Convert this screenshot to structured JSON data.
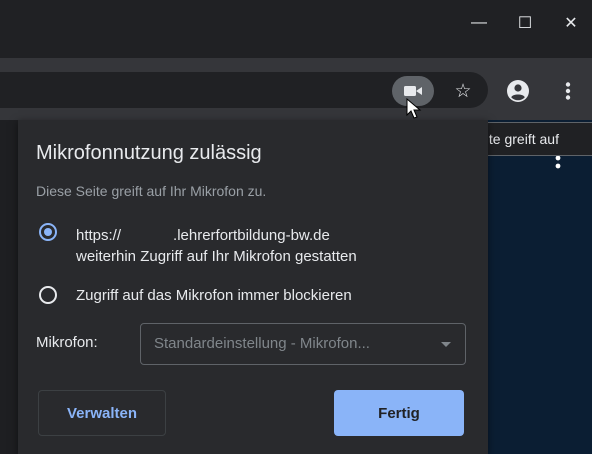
{
  "window": {
    "minimize_glyph": "—",
    "maximize_glyph": "☐",
    "close_glyph": "✕"
  },
  "toolbar": {
    "icons": [
      "camera-icon",
      "star-icon",
      "profile-icon",
      "menu-icon"
    ],
    "star_glyph": "☆"
  },
  "tooltip": {
    "text": "Diese Seite greift auf"
  },
  "popup": {
    "title": "Mikrofonnutzung zulässig",
    "description": "Diese Seite greift auf Ihr Mikrofon zu.",
    "options": [
      {
        "line1_prefix": "https://",
        "line1_suffix": ".lehrerfortbildung-bw.de",
        "line2": "weiterhin Zugriff auf Ihr Mikrofon gestatten",
        "selected": true
      },
      {
        "line1": "Zugriff auf das Mikrofon immer blockieren",
        "selected": false
      }
    ],
    "mic_label": "Mikrofon:",
    "mic_value": "Standardeinstellung - Mikrofon...",
    "manage_label": "Verwalten",
    "done_label": "Fertig"
  },
  "colors": {
    "accent": "#8ab4f8",
    "popup_bg": "#292a2d",
    "toolbar_bg": "#35363a",
    "page_bg": "#0b1e33"
  }
}
